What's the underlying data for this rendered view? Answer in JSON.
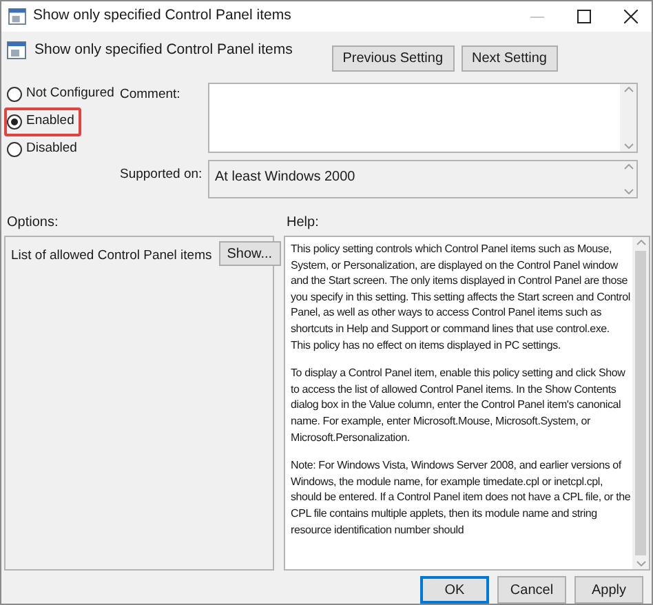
{
  "window": {
    "title": "Show only specified Control Panel items"
  },
  "header": {
    "title": "Show only specified Control Panel items",
    "buttons": [
      {
        "label": "Previous Setting"
      },
      {
        "label": "Next Setting"
      }
    ]
  },
  "state_options": [
    {
      "label": "Not Configured",
      "selected": false
    },
    {
      "label": "Enabled",
      "selected": true
    },
    {
      "label": "Disabled",
      "selected": false
    }
  ],
  "comment": {
    "label": "Comment:"
  },
  "supported_on": {
    "label": "Supported on:",
    "value": "At least Windows 2000"
  },
  "options": {
    "label": "Options:",
    "item_label": "List of allowed Control Panel items",
    "button": "Show..."
  },
  "help": {
    "label": "Help:",
    "paragraphs": [
      "This policy setting controls which Control Panel items such as Mouse, System, or Personalization, are displayed on the Control Panel window and the Start screen. The only items displayed in Control Panel are those you specify in this setting. This setting affects the Start screen and Control Panel, as well as other ways to access Control Panel items such as shortcuts in Help and Support or command lines that use control.exe. This policy has no effect on items displayed in PC settings.",
      "To display a Control Panel item, enable this policy setting and click Show to access the list of allowed Control Panel items. In the Show Contents dialog box in the Value column, enter the Control Panel item's canonical name. For example, enter Microsoft.Mouse, Microsoft.System, or Microsoft.Personalization.",
      "Note: For Windows Vista, Windows Server 2008, and earlier versions of Windows, the module name, for example timedate.cpl or inetcpl.cpl, should be entered. If a Control Panel item does not have a CPL file, or the CPL file contains multiple applets, then its module name and string resource identification number should"
    ]
  },
  "footer_buttons": [
    {
      "label": "OK",
      "kind": "default"
    },
    {
      "label": "Cancel",
      "kind": "normal"
    },
    {
      "label": "Apply",
      "kind": "normal"
    }
  ]
}
